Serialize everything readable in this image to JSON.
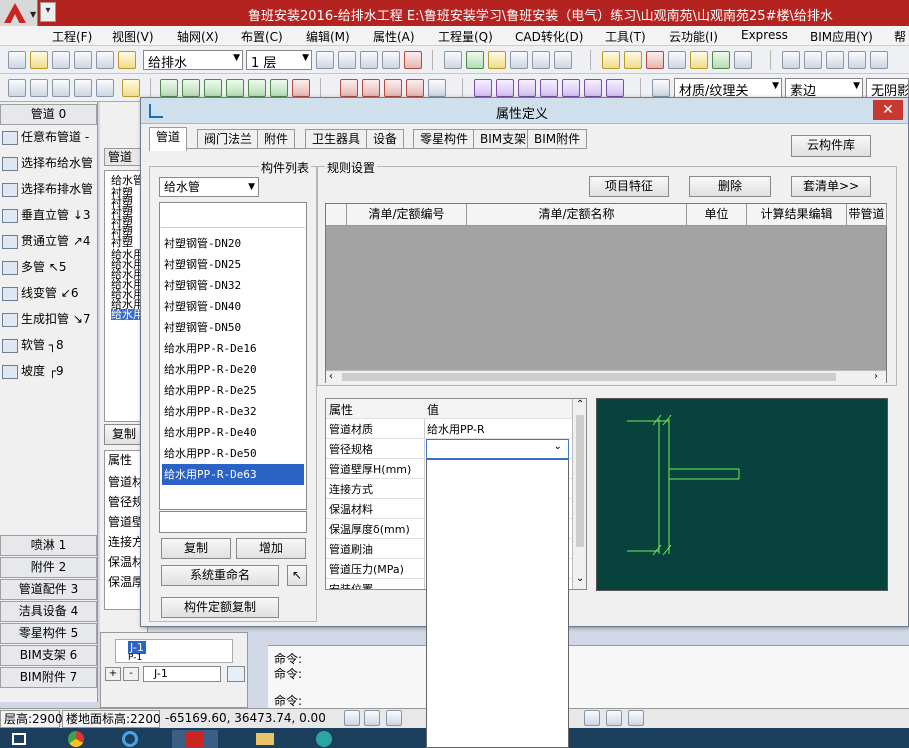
{
  "window": {
    "title": "鲁班安装2016-给排水工程    E:\\鲁班安装学习\\鲁班安装（电气）练习\\山观南苑\\山观南苑25#楼\\给排水"
  },
  "menubar": [
    "工程(F)",
    "视图(V)",
    "轴网(X)",
    "布置(C)",
    "编辑(M)",
    "属性(A)",
    "工程量(Q)",
    "CAD转化(D)",
    "工具(T)",
    "云功能(I)",
    "Express",
    "BIM应用(Y)",
    "帮"
  ],
  "toolbar": {
    "system_combo": "给排水",
    "floor_combo": "1 层",
    "material_combo": "材质/纹理关",
    "render_combo": "素边",
    "wireframe_combo": "无阴影"
  },
  "leftpanel": {
    "header": "管道 0",
    "tools": [
      "任意布管道 -",
      "选择布给水管",
      "选择布排水管",
      "垂直立管  ↓3",
      "贯通立管  ↗4",
      "多管  ↖5",
      "线变管  ↙6",
      "生成扣管  ↘7",
      "软管  ┐8",
      "坡度  ┌9"
    ],
    "categories": [
      "喷淋 1",
      "附件 2",
      "管道配件 3",
      "洁具设备 4",
      "零星构件 5",
      "BIM支架 6",
      "BIM附件 7"
    ]
  },
  "midpanel": {
    "header": "管道",
    "lines": [
      "给水管",
      "衬塑",
      "衬塑",
      "衬塑",
      "衬塑",
      "衬塑",
      "衬塑",
      "给水用",
      "给水用",
      "给水用",
      "给水用",
      "给水用",
      "给水用",
      "给水用"
    ],
    "copy_btn": "复制",
    "prop_header": "属性",
    "props": [
      "管道材",
      "管径规",
      "管道壁",
      "连接方",
      "保温材",
      "保温厚"
    ],
    "tree": [
      "J-1",
      "P-1"
    ],
    "tree_input": "J-1"
  },
  "dialog": {
    "title": "属性定义",
    "tabs": [
      "管道",
      "阀门法兰",
      "附件",
      "卫生器具",
      "设备",
      "零星构件",
      "BIM支架",
      "BIM附件"
    ],
    "cloud_btn": "云构件库",
    "component_list_label": "构件列表",
    "type_combo": "给水管",
    "components": [
      "衬塑钢管-DN20",
      "衬塑钢管-DN25",
      "衬塑钢管-DN32",
      "衬塑钢管-DN40",
      "衬塑钢管-DN50",
      "给水用PP-R-De16",
      "给水用PP-R-De20",
      "给水用PP-R-De25",
      "给水用PP-R-De32",
      "给水用PP-R-De40",
      "给水用PP-R-De50",
      "给水用PP-R-De63"
    ],
    "selected_component": "给水用PP-R-De63",
    "buttons": {
      "copy": "复制",
      "add": "增加",
      "rename": "系统重命名",
      "quota_copy": "构件定额复制"
    },
    "rules_label": "规则设置",
    "rule_buttons": {
      "item_feature": "项目特征",
      "delete": "删除",
      "apply_list": "套清单>>"
    },
    "rule_columns": [
      "",
      "清单/定额编号",
      "清单/定额名称",
      "单位",
      "计算结果编辑",
      "带管道"
    ],
    "prop_columns": [
      "属性",
      "值"
    ],
    "properties": [
      {
        "name": "管道材质",
        "value": "给水用PP-R"
      },
      {
        "name": "管径规格",
        "value": ""
      },
      {
        "name": "管道壁厚H(mm)",
        "value": ""
      },
      {
        "name": "连接方式",
        "value": ""
      },
      {
        "name": "保温材料",
        "value": ""
      },
      {
        "name": "保温厚度δ(mm)",
        "value": ""
      },
      {
        "name": "管道刷油",
        "value": ""
      },
      {
        "name": "管道压力(MPa)",
        "value": ""
      },
      {
        "name": "安装位置",
        "value": ""
      }
    ]
  },
  "command": {
    "lines": [
      "命令:",
      "命令:",
      "命令:"
    ]
  },
  "status": {
    "floor_height": "层高:2900",
    "floor_elev": "楼地面标高:2200",
    "coords": "-65169.60,  36473.74,  0.00"
  }
}
